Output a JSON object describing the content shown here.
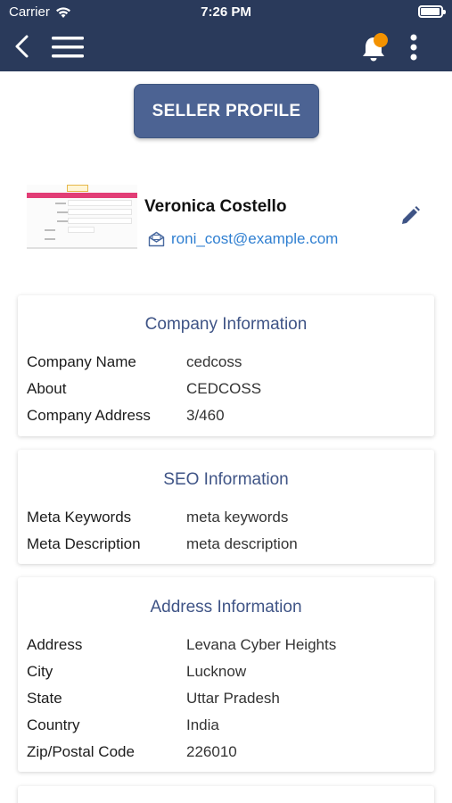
{
  "status_bar": {
    "carrier": "Carrier",
    "time": "7:26 PM",
    "battery_level": 0.95
  },
  "nav": {
    "icons": [
      "back-arrow-icon",
      "hamburger-menu-icon",
      "bell-icon",
      "more-vertical-icon"
    ],
    "notification_badge_color": "#f39200",
    "bar_color": "#2a3a5b"
  },
  "seller_button": {
    "label": "SELLER PROFILE",
    "color": "#4c6393"
  },
  "profile": {
    "name": "Veronica Costello",
    "email": "roni_cost@example.com"
  },
  "company": {
    "title": "Company Information",
    "rows": [
      {
        "label": "Company Name",
        "value": "cedcoss"
      },
      {
        "label": "About",
        "value": "CEDCOSS"
      },
      {
        "label": "Company Address",
        "value": "3/460"
      }
    ]
  },
  "seo": {
    "title": "SEO Information",
    "rows": [
      {
        "label": "Meta Keywords",
        "value": "meta keywords"
      },
      {
        "label": "Meta Description",
        "value": "meta description"
      }
    ]
  },
  "address": {
    "title": "Address Information",
    "rows": [
      {
        "label": "Address",
        "value": "Levana Cyber Heights"
      },
      {
        "label": "City",
        "value": "Lucknow"
      },
      {
        "label": "State",
        "value": "Uttar Pradesh"
      },
      {
        "label": "Country",
        "value": "India"
      },
      {
        "label": "Zip/Postal Code",
        "value": "226010"
      }
    ]
  }
}
